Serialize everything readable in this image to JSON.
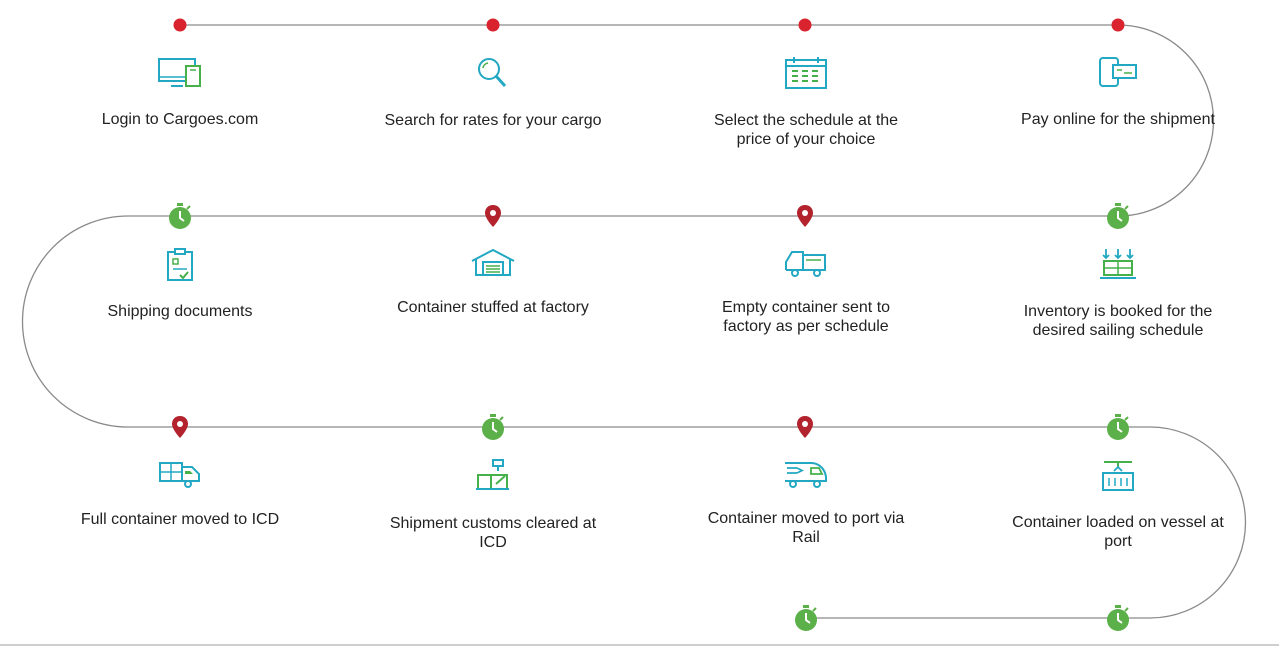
{
  "colors": {
    "line": "#8a8a8a",
    "dot": "#d9232e",
    "pin": "#b3232e",
    "timer": "#5cb04a",
    "icon_teal": "#22a8c2",
    "icon_green": "#46b04a"
  },
  "steps": [
    {
      "label": "Login to Cargoes.com",
      "icon": "computer-icon"
    },
    {
      "label": "Search for rates for your cargo",
      "icon": "magnifier-icon"
    },
    {
      "label": "Select the schedule at the price of your choice",
      "icon": "calendar-icon"
    },
    {
      "label": "Pay online for the shipment",
      "icon": "mobile-payment-icon"
    },
    {
      "label": "Shipping documents",
      "icon": "clipboard-icon"
    },
    {
      "label": "Container stuffed at factory",
      "icon": "warehouse-icon"
    },
    {
      "label": "Empty container sent to factory as per schedule",
      "icon": "truck-icon"
    },
    {
      "label": "Inventory is booked for the desired sailing schedule",
      "icon": "inventory-icon"
    },
    {
      "label": "Full container moved to ICD",
      "icon": "container-truck-icon"
    },
    {
      "label": "Shipment customs cleared at ICD",
      "icon": "customs-icon"
    },
    {
      "label": "Container moved to port via Rail",
      "icon": "train-icon"
    },
    {
      "label": "Container loaded on vessel at port",
      "icon": "crane-icon"
    }
  ],
  "markers": [
    {
      "type": "dot"
    },
    {
      "type": "dot"
    },
    {
      "type": "dot"
    },
    {
      "type": "dot"
    },
    {
      "type": "timer"
    },
    {
      "type": "pin"
    },
    {
      "type": "pin"
    },
    {
      "type": "timer"
    },
    {
      "type": "pin"
    },
    {
      "type": "timer"
    },
    {
      "type": "pin"
    },
    {
      "type": "timer"
    },
    {
      "type": "timer"
    },
    {
      "type": "timer"
    }
  ]
}
